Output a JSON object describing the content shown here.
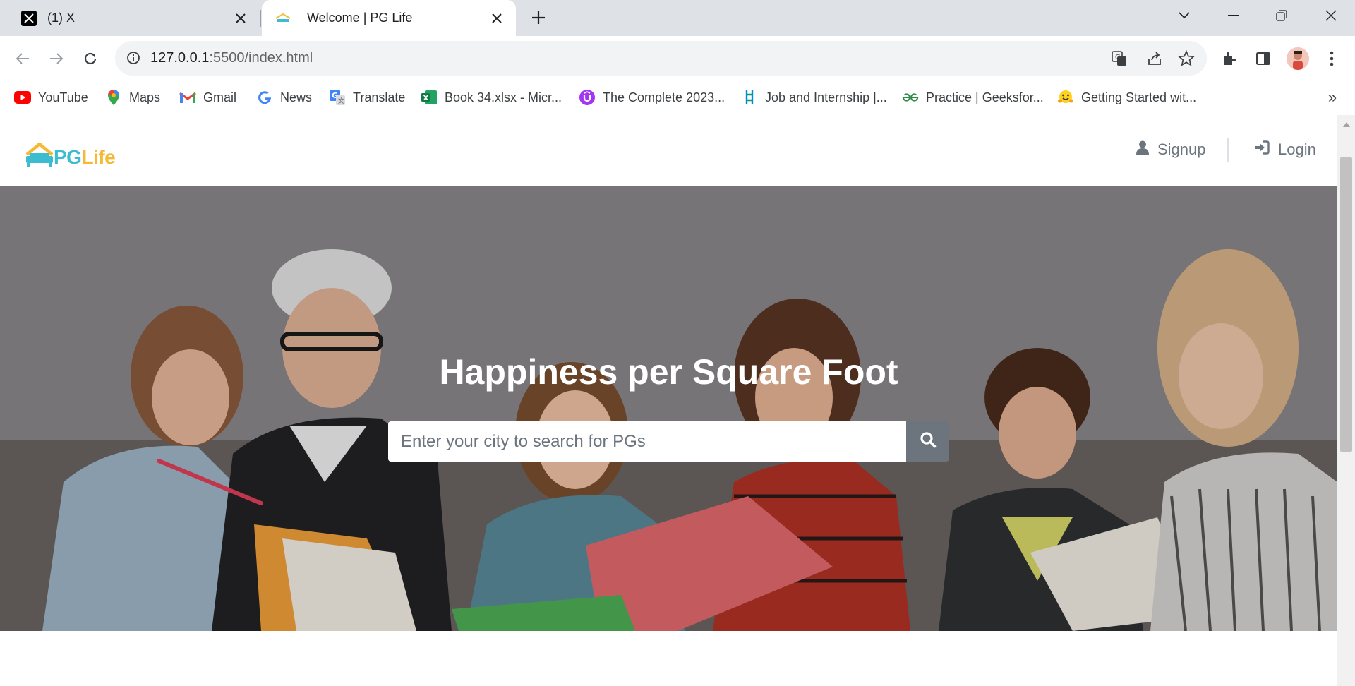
{
  "tabs": [
    {
      "title": "(1) X",
      "favicon": "x-logo-icon",
      "active": false
    },
    {
      "title": "Welcome | PG Life",
      "favicon": "pglife-favicon-icon",
      "active": true
    }
  ],
  "omnibox": {
    "host": "127.0.0.1",
    "path": ":5500/index.html"
  },
  "bookmarks": [
    {
      "label": "YouTube",
      "icon": "youtube-icon"
    },
    {
      "label": "Maps",
      "icon": "maps-icon"
    },
    {
      "label": "Gmail",
      "icon": "gmail-icon"
    },
    {
      "label": "News",
      "icon": "google-icon"
    },
    {
      "label": "Translate",
      "icon": "translate-icon"
    },
    {
      "label": "Book 34.xlsx - Micr...",
      "icon": "excel-icon"
    },
    {
      "label": "The Complete 2023...",
      "icon": "udemy-icon"
    },
    {
      "label": "Job and Internship |...",
      "icon": "internshala-icon"
    },
    {
      "label": "Practice | Geeksfor...",
      "icon": "geeksforgeeks-icon"
    },
    {
      "label": "Getting Started wit...",
      "icon": "huggingface-icon"
    }
  ],
  "site": {
    "logo_pg": "PG",
    "logo_life": "Life",
    "nav": {
      "signup": "Signup",
      "login": "Login"
    },
    "hero": {
      "title": "Happiness per Square Foot",
      "search_placeholder": "Enter your city to search for PGs"
    }
  },
  "colors": {
    "logo_teal": "#3cbcd0",
    "logo_yellow": "#f5b934",
    "nav_gray": "#6c757d",
    "search_button": "#6c757d"
  }
}
